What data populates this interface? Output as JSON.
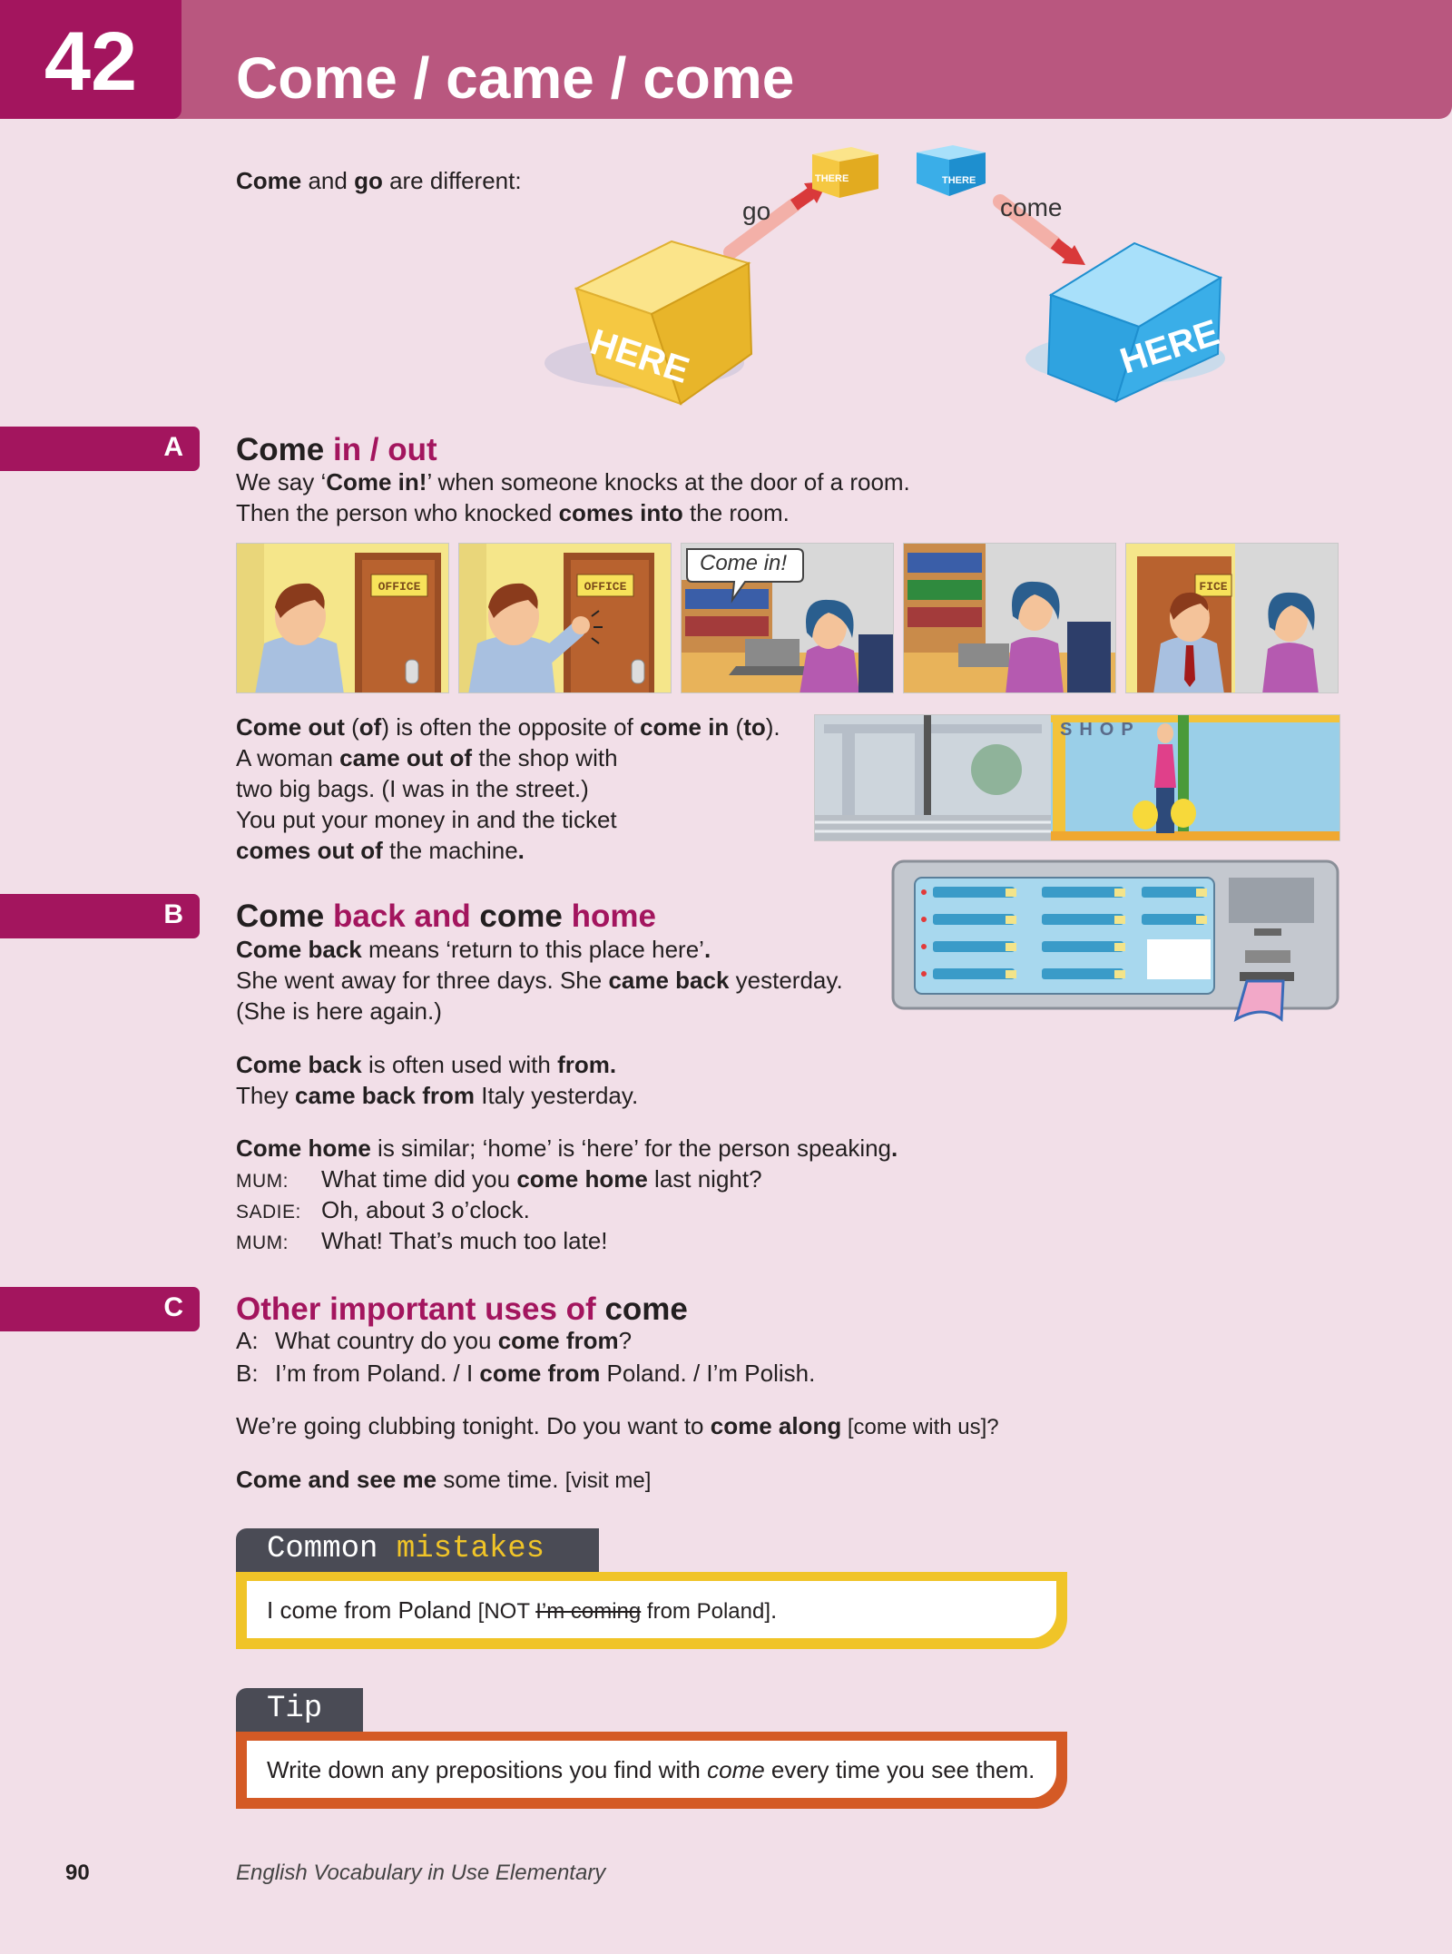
{
  "header": {
    "unit_number": "42",
    "title": "Come / came / come"
  },
  "intro": {
    "w1": "Come",
    "t1": " and ",
    "w2": "go",
    "t2": " are different:",
    "diagram": {
      "go_label": "go",
      "come_label": "come",
      "here": "HERE",
      "there": "THERE",
      "colors": {
        "go_cube": "#f5c842",
        "come_cube": "#3aaee8",
        "arrow": "#d9393a"
      }
    }
  },
  "section_a": {
    "letter": "A",
    "title": {
      "p1": "Come ",
      "p2": "in / out"
    },
    "l1": {
      "a": "We say ‘",
      "b": "Come in!",
      "c": "’ when someone knocks at the door of a room."
    },
    "l2": {
      "a": "Then the person who knocked ",
      "b": "comes into",
      "c": " the room."
    },
    "strip": {
      "office": "OFFICE",
      "office_cut": "FICE",
      "bubble": "Come in!"
    },
    "out": {
      "l1": {
        "a": "Come out",
        "b": " (",
        "c": "of",
        "d": ") is often the opposite of ",
        "e": "come in",
        "f": " (",
        "g": "to",
        "h": ")."
      },
      "l2": {
        "a": "A woman ",
        "b": "came out of",
        "c": " the shop with"
      },
      "l3": "two big bags. (I was in the street.)",
      "l4": "You put your money in and the ticket",
      "l5": {
        "a": "comes out of",
        "b": " the machine",
        "c": "."
      },
      "shop_sign": "SHOP"
    }
  },
  "section_b": {
    "letter": "B",
    "title": {
      "p1": "Come ",
      "p2": "back and ",
      "p3": "come ",
      "p4": "home"
    },
    "l1": {
      "a": "Come back",
      "b": " means ‘return to this place here’",
      "c": "."
    },
    "l2": {
      "a": "She went away for three days. She ",
      "b": "came back",
      "c": " yesterday."
    },
    "l3": "(She is here again.)",
    "l4": {
      "a": "Come back",
      "b": " is often used with ",
      "c": "from."
    },
    "l5": {
      "a": "They ",
      "b": "came back from",
      "c": " Italy yesterday."
    },
    "l6": {
      "a": "Come home",
      "b": " is similar; ‘home’ is ‘here’ for the person speaking",
      "c": "."
    },
    "dialogue": [
      {
        "speaker": "MUM:",
        "a": "What time did you ",
        "b": "come home",
        "c": " last night?"
      },
      {
        "speaker": "SADIE:",
        "a": "Oh, about 3 o’clock.",
        "b": "",
        "c": ""
      },
      {
        "speaker": "MUM:",
        "a": "What! That’s much too late!",
        "b": "",
        "c": ""
      }
    ]
  },
  "section_c": {
    "letter": "C",
    "title": {
      "p1": "Other important uses of ",
      "p2": "come"
    },
    "qa": [
      {
        "speaker": "A:",
        "a": "What country do you ",
        "b": "come from",
        "c": "?",
        "d": "",
        "e": ""
      },
      {
        "speaker": "B:",
        "a": "I’m from Poland. / I ",
        "b": "come from",
        "c": " Poland. / I’m Polish.",
        "d": "",
        "e": ""
      }
    ],
    "l3": {
      "a": "We’re going clubbing tonight. Do you want to ",
      "b": "come along",
      "c": " [come with us]?"
    },
    "l4": {
      "a": "Come and see me",
      "b": " some time. ",
      "c": "[visit me]"
    }
  },
  "mistakes": {
    "label_1": "Common ",
    "label_2": "mistakes",
    "t1": "I come from Poland ",
    "t2": "[NOT ",
    "t3": "I’m coming",
    "t4": " from Poland]",
    "t5": ".",
    "colors": {
      "border": "#f0c428",
      "highlight": "#f0c428"
    }
  },
  "tip": {
    "label": "Tip",
    "t1": "Write down any prepositions you find with ",
    "t2": "come",
    "t3": " every time you see them.",
    "colors": {
      "border": "#d45a25"
    }
  },
  "footer": {
    "page": "90",
    "book": "English Vocabulary in Use Elementary"
  }
}
